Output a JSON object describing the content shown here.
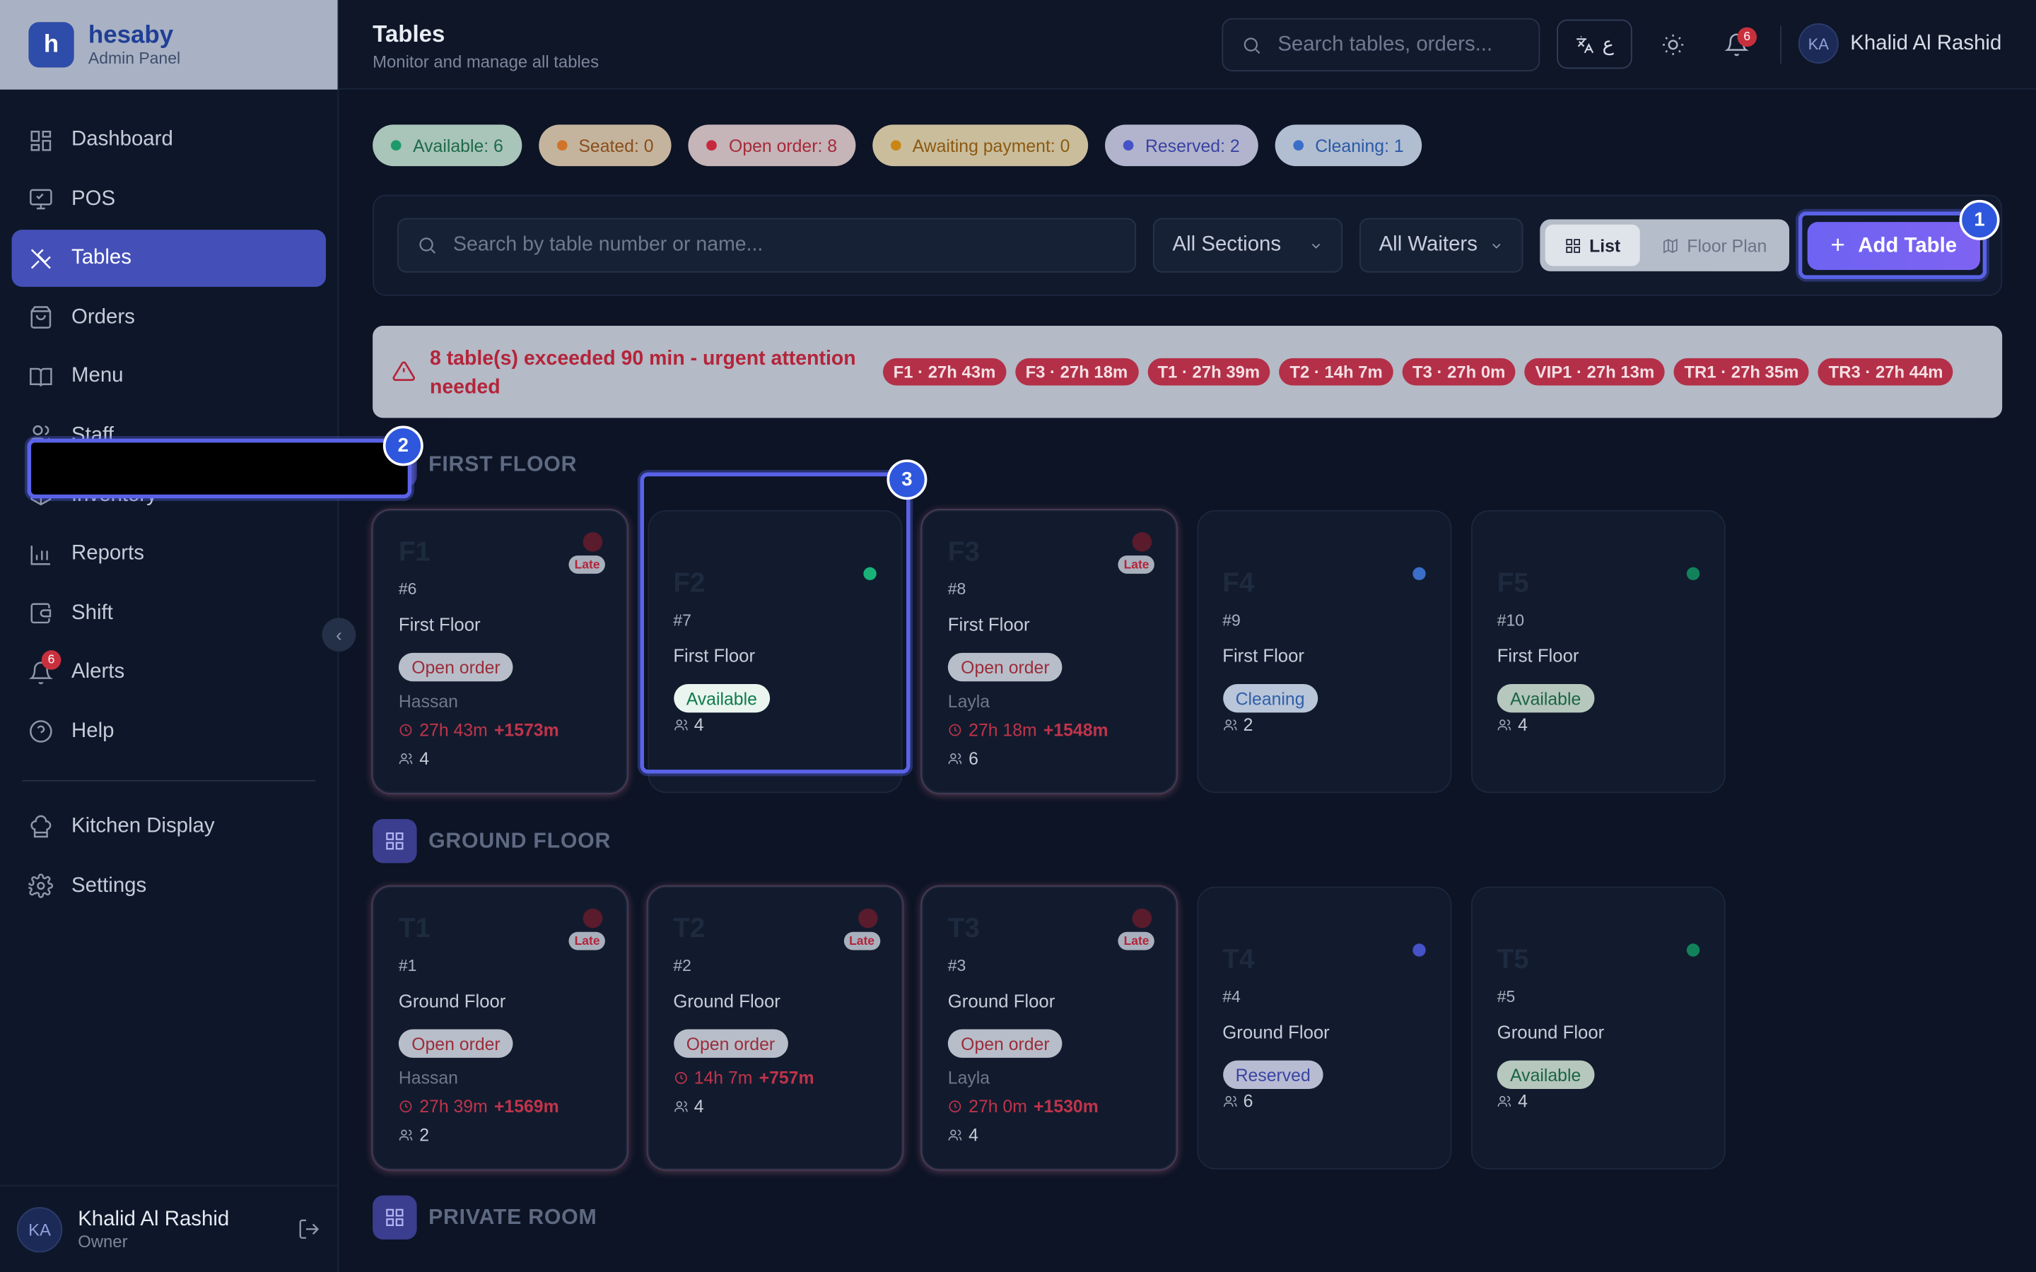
{
  "brand": {
    "logo": "h",
    "title": "hesaby",
    "subtitle": "Admin Panel"
  },
  "sidebar": {
    "items": [
      {
        "label": "Dashboard",
        "icon": "dashboard-icon"
      },
      {
        "label": "POS",
        "icon": "monitor-icon"
      },
      {
        "label": "Tables",
        "icon": "utensils-icon",
        "active": true
      },
      {
        "label": "Orders",
        "icon": "shopping-bag-icon"
      },
      {
        "label": "Menu",
        "icon": "book-icon"
      },
      {
        "label": "Staff",
        "icon": "users-icon"
      },
      {
        "label": "Inventory",
        "icon": "box-icon"
      },
      {
        "label": "Reports",
        "icon": "bar-chart-icon"
      },
      {
        "label": "Shift",
        "icon": "wallet-icon"
      },
      {
        "label": "Alerts",
        "icon": "bell-icon",
        "badge": "6"
      },
      {
        "label": "Help",
        "icon": "help-icon"
      }
    ],
    "items2": [
      {
        "label": "Kitchen Display",
        "icon": "chef-hat-icon"
      },
      {
        "label": "Settings",
        "icon": "gear-icon"
      }
    ],
    "user": {
      "initials": "KA",
      "name": "Khalid Al Rashid",
      "role": "Owner"
    }
  },
  "topbar": {
    "title": "Tables",
    "subtitle": "Monitor and manage all tables",
    "search_placeholder": "Search tables, orders...",
    "lang": "ع",
    "notif_count": "6",
    "user_initials": "KA",
    "user_name": "Khalid Al Rashid"
  },
  "status_chips": [
    {
      "label": "Available: 6",
      "bg": "#a9c4b9",
      "fg": "#1f6a4d",
      "dot": "#1d9a6a"
    },
    {
      "label": "Seated: 0",
      "bg": "#c5b49d",
      "fg": "#8a4e1c",
      "dot": "#d0742a"
    },
    {
      "label": "Open order: 8",
      "bg": "#c5b4b8",
      "fg": "#a62a3a",
      "dot": "#c6283d"
    },
    {
      "label": "Awaiting payment: 0",
      "bg": "#c9bd9c",
      "fg": "#8c5a12",
      "dot": "#c98614"
    },
    {
      "label": "Reserved: 2",
      "bg": "#b1b4cc",
      "fg": "#3a43a3",
      "dot": "#4652c8"
    },
    {
      "label": "Cleaning: 1",
      "bg": "#b1bdd1",
      "fg": "#2b5aa6",
      "dot": "#3a6ec8"
    }
  ],
  "filters": {
    "search_placeholder": "Search by table number or name...",
    "section": "All Sections",
    "waiter": "All Waiters",
    "view_list": "List",
    "view_floor": "Floor Plan",
    "add_label": "Add Table"
  },
  "alert": {
    "message": "8 table(s) exceeded 90 min - urgent attention needed",
    "tables": [
      "F1 · 27h 43m",
      "F3 · 27h 18m",
      "T1 · 27h 39m",
      "T2 · 14h 7m",
      "T3 · 27h 0m",
      "VIP1 · 27h 13m",
      "TR1 · 27h 35m",
      "TR3 · 27h 44m"
    ]
  },
  "sections": [
    {
      "title": "FIRST FLOOR",
      "tables": [
        {
          "name": "F1",
          "num": "#6",
          "floor": "First Floor",
          "status": "Open order",
          "kind": "open",
          "waiter": "Hassan",
          "time": "27h 43m",
          "over": "+1573m",
          "seats": "4",
          "late": true
        },
        {
          "name": "F2",
          "num": "#7",
          "floor": "First Floor",
          "status": "Available",
          "kind": "avail",
          "seats": "4",
          "dot": "#19b37a"
        },
        {
          "name": "F3",
          "num": "#8",
          "floor": "First Floor",
          "status": "Open order",
          "kind": "open",
          "waiter": "Layla",
          "time": "27h 18m",
          "over": "+1548m",
          "seats": "6",
          "late": true
        },
        {
          "name": "F4",
          "num": "#9",
          "floor": "First Floor",
          "status": "Cleaning",
          "kind": "clean",
          "seats": "2",
          "dot": "#3a6ec8"
        },
        {
          "name": "F5",
          "num": "#10",
          "floor": "First Floor",
          "status": "Available",
          "kind": "avail2",
          "seats": "4",
          "dot": "#12825a"
        }
      ]
    },
    {
      "title": "GROUND FLOOR",
      "tables": [
        {
          "name": "T1",
          "num": "#1",
          "floor": "Ground Floor",
          "status": "Open order",
          "kind": "open",
          "waiter": "Hassan",
          "time": "27h 39m",
          "over": "+1569m",
          "seats": "2",
          "late": true
        },
        {
          "name": "T2",
          "num": "#2",
          "floor": "Ground Floor",
          "status": "Open order",
          "kind": "open",
          "time": "14h 7m",
          "over": "+757m",
          "seats": "4",
          "late": true
        },
        {
          "name": "T3",
          "num": "#3",
          "floor": "Ground Floor",
          "status": "Open order",
          "kind": "open",
          "waiter": "Layla",
          "time": "27h 0m",
          "over": "+1530m",
          "seats": "4",
          "late": true
        },
        {
          "name": "T4",
          "num": "#4",
          "floor": "Ground Floor",
          "status": "Reserved",
          "kind": "res",
          "seats": "6",
          "dot": "#4652c8"
        },
        {
          "name": "T5",
          "num": "#5",
          "floor": "Ground Floor",
          "status": "Available",
          "kind": "avail2",
          "seats": "4",
          "dot": "#12825a"
        }
      ]
    },
    {
      "title": "PRIVATE ROOM",
      "tables": []
    }
  ],
  "late_label": "Late",
  "markers": [
    "1",
    "2",
    "3"
  ]
}
